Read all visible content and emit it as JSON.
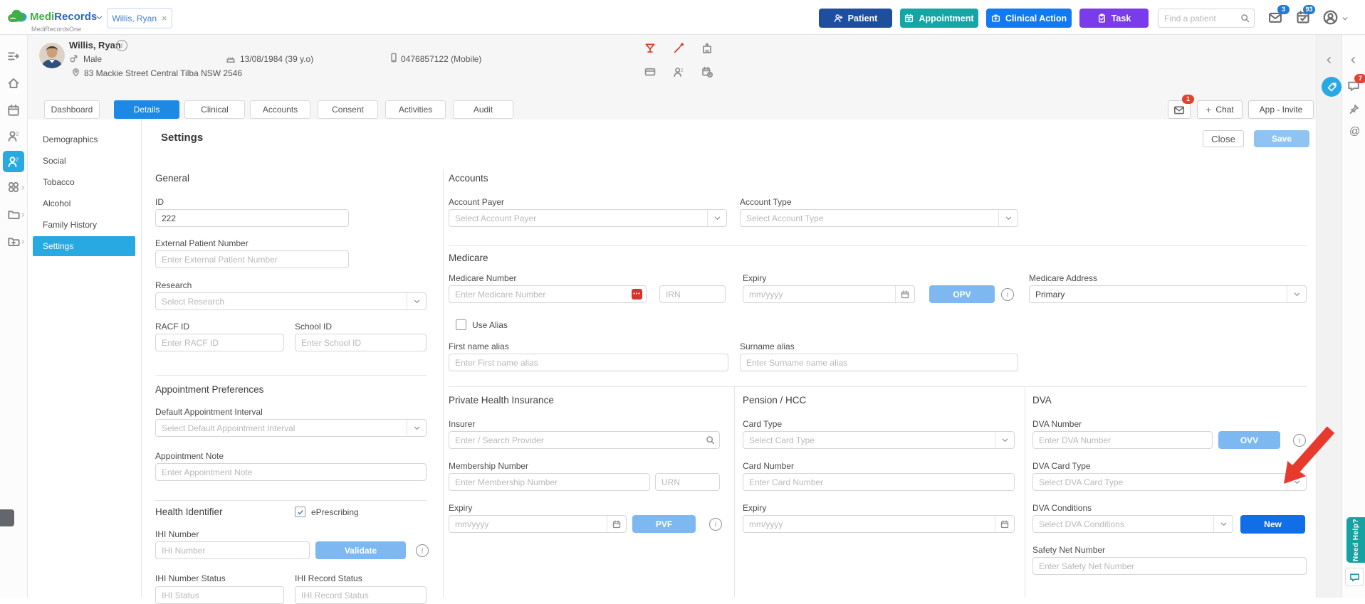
{
  "colors": {
    "brand_green": "#3fae49",
    "brand_blue": "#2d69b3",
    "patient_btn": "#1d4f9e",
    "appointment_btn": "#14a5a5",
    "clinical_btn": "#1179f2",
    "task_btn": "#7a3bea",
    "active_tab": "#1e88e5",
    "sidebar_active": "#29a9e2",
    "save_btn": "#8fc3f2",
    "light_action_btn": "#7db9f0",
    "new_btn": "#106ee8",
    "badge_blue": "#1f7bd8",
    "alert_red": "#e8402f",
    "annotation_arrow": "#e8392e",
    "help_teal": "#17a2a2"
  },
  "topbar": {
    "brand": "MediRecords",
    "brand_part1": "Medi",
    "brand_part2": "Records",
    "brand_sub": "MediRecordsOne",
    "patient_tab": "Willis, Ryan",
    "btn_patient": "Patient",
    "btn_appointment": "Appointment",
    "btn_clinical": "Clinical Action",
    "btn_task": "Task",
    "search_placeholder": "Find a patient",
    "mail_badge": "3",
    "task_badge": "93"
  },
  "banner": {
    "name": "Willis, Ryan",
    "gender": "Male",
    "dob": "13/08/1984 (39 y.o)",
    "phone": "0476857122 (Mobile)",
    "address": "83 Mackie Street Central Tilba NSW 2546"
  },
  "tabs": {
    "dashboard": "Dashboard",
    "details": "Details",
    "clinical": "Clinical",
    "accounts": "Accounts",
    "consent": "Consent",
    "activities": "Activities",
    "audit": "Audit",
    "mail_badge": "1",
    "chat": "Chat",
    "app_invite": "App - Invite"
  },
  "menu": {
    "demographics": "Demographics",
    "social": "Social",
    "tobacco": "Tobacco",
    "alcohol": "Alcohol",
    "family_history": "Family History",
    "settings": "Settings"
  },
  "page": {
    "title": "Settings",
    "close": "Close",
    "save": "Save"
  },
  "general": {
    "heading": "General",
    "id_label": "ID",
    "id_value": "222",
    "epn_label": "External Patient Number",
    "epn_placeholder": "Enter External Patient Number",
    "research_label": "Research",
    "research_placeholder": "Select Research",
    "racf_label": "RACF ID",
    "racf_placeholder": "Enter RACF ID",
    "school_label": "School ID",
    "school_placeholder": "Enter School ID"
  },
  "appointment": {
    "heading": "Appointment Preferences",
    "interval_label": "Default Appointment Interval",
    "interval_placeholder": "Select Default Appointment Interval",
    "note_label": "Appointment Note",
    "note_placeholder": "Enter Appointment Note"
  },
  "health_id": {
    "heading": "Health Identifier",
    "eprescribing": "ePrescribing",
    "ihi_label": "IHI Number",
    "ihi_placeholder": "IHI Number",
    "validate": "Validate",
    "status_label": "IHI Number Status",
    "status_placeholder": "IHI Status",
    "record_label": "IHI Record Status",
    "record_placeholder": "IHI Record Status"
  },
  "accounts": {
    "heading": "Accounts",
    "payer_label": "Account Payer",
    "payer_placeholder": "Select Account Payer",
    "type_label": "Account Type",
    "type_placeholder": "Select Account Type"
  },
  "medicare": {
    "heading": "Medicare",
    "number_label": "Medicare Number",
    "number_placeholder": "Enter Medicare Number",
    "irn_placeholder": "IRN",
    "expiry_label": "Expiry",
    "expiry_placeholder": "mm/yyyy",
    "opv": "OPV",
    "address_label": "Medicare Address",
    "address_value": "Primary",
    "use_alias": "Use Alias",
    "first_alias_label": "First name alias",
    "first_alias_placeholder": "Enter First name alias",
    "surname_alias_label": "Surname alias",
    "surname_alias_placeholder": "Enter Surname name alias"
  },
  "phi": {
    "heading": "Private Health Insurance",
    "insurer_label": "Insurer",
    "insurer_placeholder": "Enter / Search Provider",
    "membership_label": "Membership Number",
    "membership_placeholder": "Enter Membership Number",
    "urn_placeholder": "URN",
    "expiry_label": "Expiry",
    "expiry_placeholder": "mm/yyyy",
    "pvf": "PVF"
  },
  "pension": {
    "heading": "Pension / HCC",
    "card_type_label": "Card Type",
    "card_type_placeholder": "Select Card Type",
    "card_number_label": "Card Number",
    "card_number_placeholder": "Enter Card Number",
    "expiry_label": "Expiry",
    "expiry_placeholder": "mm/yyyy"
  },
  "dva": {
    "heading": "DVA",
    "number_label": "DVA Number",
    "number_placeholder": "Enter DVA Number",
    "ovv": "OVV",
    "card_type_label": "DVA Card Type",
    "card_type_placeholder": "Select DVA Card Type",
    "conditions_label": "DVA Conditions",
    "conditions_placeholder": "Select DVA Conditions",
    "new": "New",
    "safety_label": "Safety Net Number",
    "safety_placeholder": "Enter Safety Net Number"
  },
  "right_rail": {
    "chat_badge": "7",
    "help": "Need Help?"
  }
}
